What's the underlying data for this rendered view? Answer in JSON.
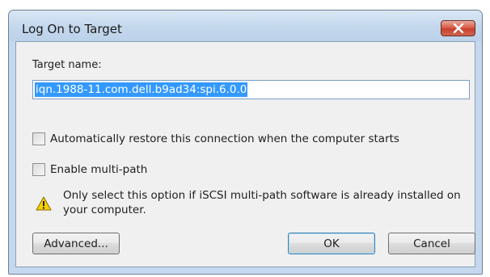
{
  "window": {
    "title": "Log On to Target"
  },
  "form": {
    "target_label": "Target name:",
    "target_value": "iqn.1988-11.com.dell.b9ad34:spi.6.0.0",
    "auto_restore_label": "Automatically restore this connection when the computer starts",
    "auto_restore_checked": false,
    "multipath_label": "Enable multi-path",
    "multipath_checked": false,
    "warning_text": "Only select this option if iSCSI multi-path software is already installed on your computer."
  },
  "buttons": {
    "advanced": "Advanced...",
    "ok": "OK",
    "cancel": "Cancel"
  },
  "icons": {
    "close": "close-icon",
    "warning": "warning-icon"
  },
  "colors": {
    "selection": "#3399ff",
    "close_button": "#c8412c",
    "warning_yellow": "#f5d000"
  }
}
